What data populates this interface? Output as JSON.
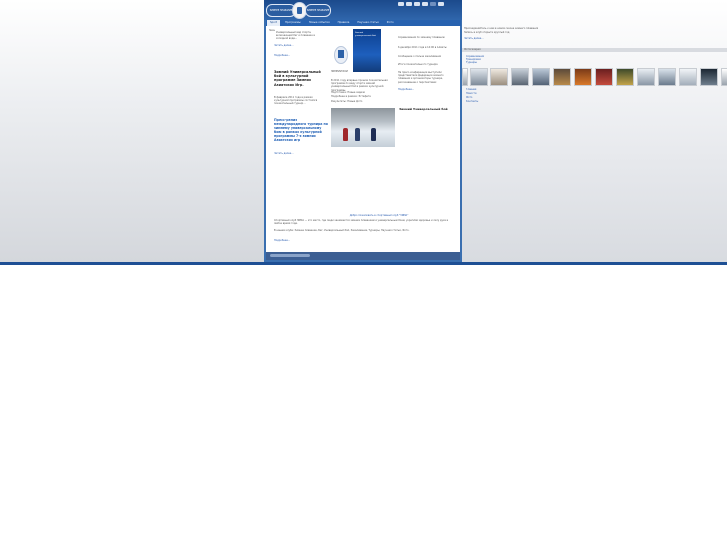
{
  "colors": {
    "brand_blue": "#1e4f94",
    "nav_blue": "#2762b0",
    "link_blue": "#2a5db0",
    "headline_blue": "#1f5fb5",
    "page_bg": "#ffffff"
  },
  "header": {
    "logo_left_text": "ЗИМНЕЕ ПЛАВАНИЕ",
    "logo_right_text": "ЗИМНЕЕ ПЛАВАНИЕ",
    "crest_icon": "crest-icon",
    "top_icons": [
      "home-icon",
      "mail-icon",
      "sitemap-icon",
      "print-icon",
      "search-icon",
      "lang-icon"
    ]
  },
  "nav": {
    "items": [
      {
        "label": "Sport",
        "active": true
      },
      {
        "label": "Программы",
        "active": false
      },
      {
        "label": "Новые события",
        "active": false
      },
      {
        "label": "Правила",
        "active": false
      },
      {
        "label": "Научная статья",
        "active": false
      },
      {
        "label": "Фото",
        "active": false
      }
    ]
  },
  "main": {
    "col1": {
      "small_title": "Зимний...",
      "intro": "Универсальный вид спорта, включающий бег и плавание в холодной воде...",
      "more_link_1": "Читать далее...",
      "more_link_2": "Подробнее...",
      "headline": "Зимний Универсальный бой в культурной программе Зимних Азиатских Игр.",
      "paragraph": "В феврале 2011 года в рамках культурной программы состоялся показательный турнир...",
      "headline_blue": "Пресс-релиз международного турнира по зимнему универсальному бою в рамках культурной программы 7-х зимних Азиатских игр",
      "more_link_3": "Читать далее..."
    },
    "col2": {
      "logo_caption": "ЗИМНИЙ БОЙ",
      "poster_text": "Зимний универсальный бой",
      "text": "В 2011 году впервые прошла показательная программа по виду спорта зимний универсальный бой в рамках культурной программы.",
      "meta_1": "Подготовка: Новые задачи",
      "meta_2": "Подробнее в рамках: Эстафета",
      "meta_3": "Результаты: Новые фото",
      "photo_caption": "Зимний Универсальный бой"
    },
    "col3": {
      "items": [
        "Соревнования по зимнему плаванию",
        "6 декабря 2011 года в 14:00 в Алматы",
        "Сообщение о пользе закаливания",
        "Итоги показательного турнира",
        "На пресс-конференции выступили представители федерации зимнего плавания и организаторы турнира, рассказавшие о перспективах",
        "Подробнее..."
      ],
      "headline": "Зимний Универсальный бой"
    },
    "footer_title": "Добро пожаловать в спортивный клуб \"ЗИМА\"",
    "footer_text": "Спортивный клуб ЗИМА — это место, где люди занимаются зимним плаванием и универсальным боем, укрепляя здоровье и силу духа в любое время года.",
    "footer_text_2": "В нашем клубе: Зимнее плавание, Бег, Универсальный бой, Закаливание, Турниры, Научная статья, Фото.",
    "footer_link": "Подробнее..."
  },
  "sidebar_right": {
    "intro": "Присоединяйтесь к нам в новом сезоне зимнего плавания",
    "intro_2": "Запись в клуб открыта круглый год",
    "more": "Читать далее...",
    "gallery_title": "Фотогалерея",
    "links": [
      "Соревнования",
      "Тренировки",
      "Турниры"
    ],
    "thumb_icons": [
      "photo-thumb-icon"
    ],
    "nav_links": [
      "Главная",
      "Новости",
      "Фото",
      "Контакты"
    ]
  }
}
